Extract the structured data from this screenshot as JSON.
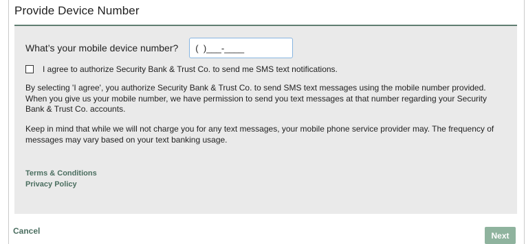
{
  "dialog": {
    "title": "Provide Device Number"
  },
  "phone": {
    "question_label": "What’s your mobile device number?",
    "input_value": "(  )___-____"
  },
  "consent": {
    "checked": false,
    "agree_label": "I agree to authorize Security Bank & Trust Co. to send me SMS text notifications.",
    "paragraph_1": "By selecting 'I agree', you authorize Security Bank & Trust Co. to send SMS text messages using the mobile number provided. When you give us your mobile number, we have permission to send you text messages at that number regarding your Security Bank & Trust Co. accounts.",
    "paragraph_2": "Keep in mind that while we will not charge you for any text messages, your mobile phone service provider may. The frequency of messages may vary based on your text banking usage."
  },
  "links": {
    "terms": "Terms & Conditions",
    "privacy": "Privacy Policy"
  },
  "footer": {
    "cancel_label": "Cancel",
    "next_label": "Next"
  },
  "colors": {
    "accent": "#4b6e60",
    "rule": "#5f7d70",
    "panel_bg": "#eaeaea",
    "next_button_bg": "#8fb39e",
    "input_border": "#86b4e0"
  }
}
